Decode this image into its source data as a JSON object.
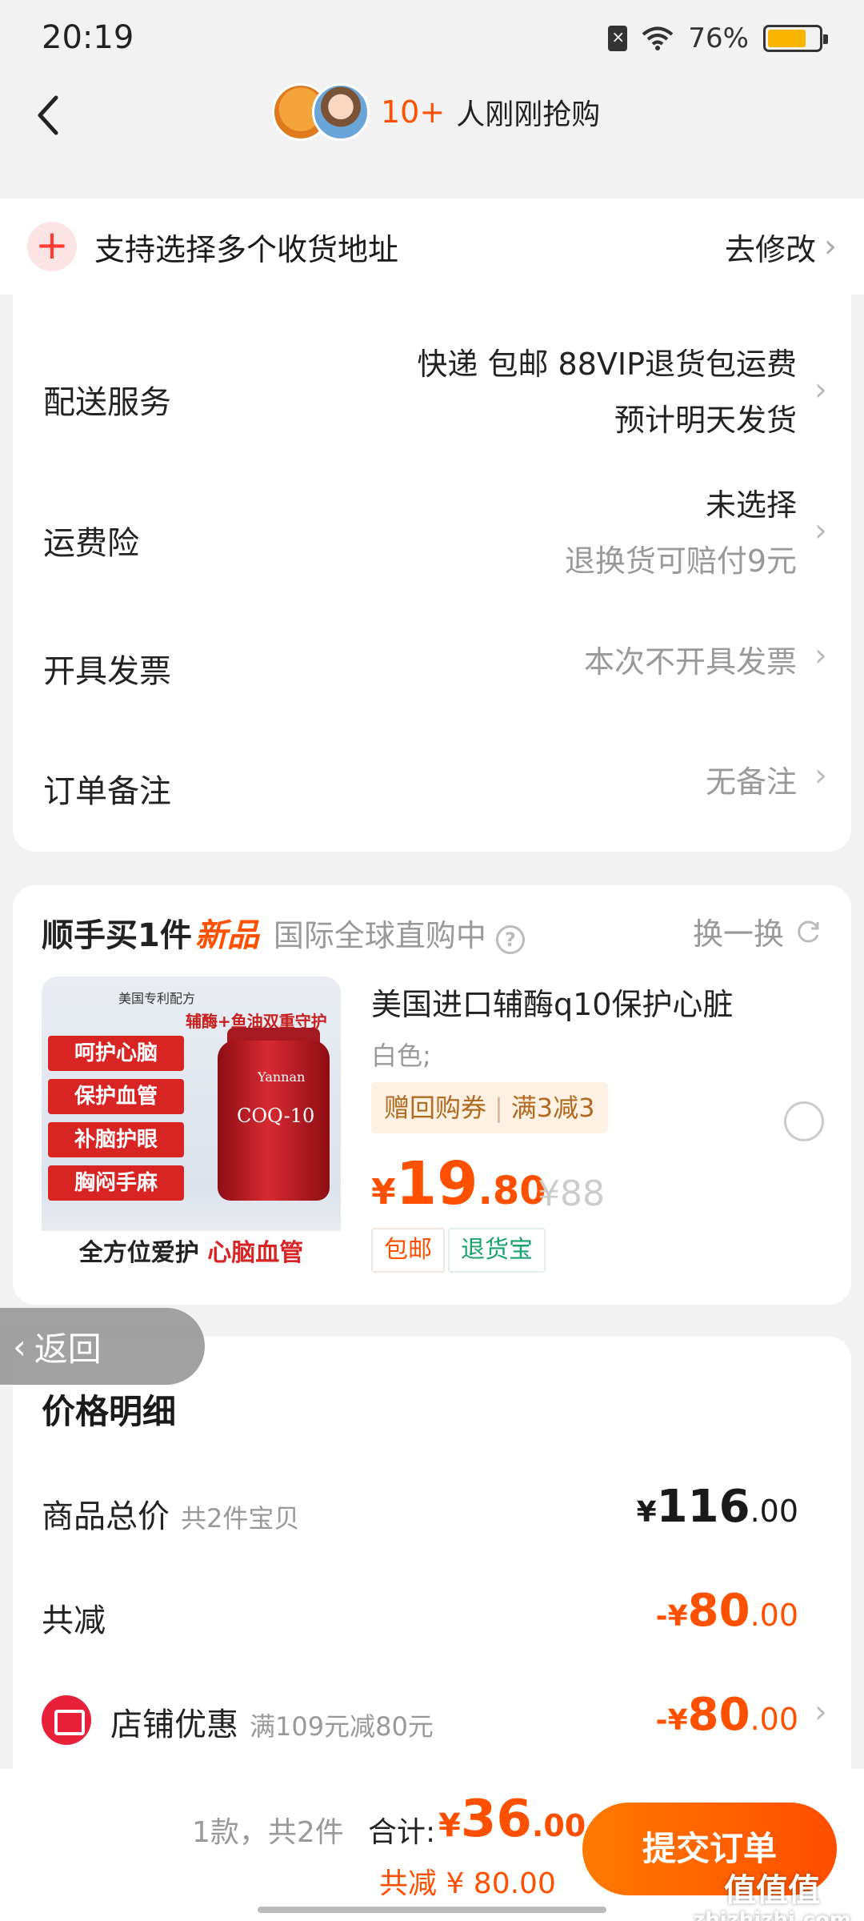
{
  "status_bar": {
    "time": "20:19",
    "battery_percent": "76%",
    "battery_level": 0.76
  },
  "header": {
    "buyers_count": "10+",
    "buyers_text": "人刚刚抢购"
  },
  "address": {
    "text": "支持选择多个收货地址",
    "modify": "去修改"
  },
  "services": {
    "delivery": {
      "label": "配送服务",
      "line1": "快递 包邮 88VIP退货包运费",
      "line2": "预计明天发货"
    },
    "insurance": {
      "label": "运费险",
      "line1": "未选择",
      "line2": "退换货可赔付9元"
    },
    "invoice": {
      "label": "开具发票",
      "value": "本次不开具发票"
    },
    "note": {
      "label": "订单备注",
      "value": "无备注"
    }
  },
  "addon": {
    "title": "顺手买1件",
    "new_tag": "新品",
    "intl": "国际全球直购中",
    "swap": "换一换",
    "product": {
      "name": "美国进口辅酶q10保护心脏",
      "spec": "白色;",
      "coupon_left": "赠回购券",
      "coupon_right": "满3减3",
      "price_currency": "¥",
      "price_int": "19",
      "price_dec": ".80",
      "orig_price": "¥88",
      "badge_post": "包邮",
      "badge_return": "退货宝",
      "image_texts": {
        "flag_text": "美国专利配方",
        "top_text": "辅酶+鱼油双重守护",
        "tags": [
          "呵护心脑",
          "保护血管",
          "补脑护眼",
          "胸闷手麻"
        ],
        "bottle_brand": "Yannan",
        "bottle_name": "COQ-10",
        "bottom_text_a": "全方位爱护",
        "bottom_text_b": "心脑血管"
      }
    }
  },
  "return_float": {
    "label": "返回"
  },
  "price_detail": {
    "title": "价格明细",
    "goods_total": {
      "label": "商品总价",
      "sub": "共2件宝贝",
      "currency": "¥",
      "int": "116",
      "dec": ".00"
    },
    "reduce": {
      "label": "共减",
      "currency": "-¥",
      "int": "80",
      "dec": ".00"
    },
    "shop_discount": {
      "label": "店铺优惠",
      "sub": "满109元减80元",
      "currency": "-¥",
      "int": "80",
      "dec": ".00"
    }
  },
  "bottom_bar": {
    "count": "1款，共2件",
    "total_label": "合计:",
    "total_currency": "¥",
    "total_int": "36",
    "total_dec": ".00",
    "saved": "共减 ¥ 80.00",
    "submit": "提交订单",
    "watermark_a": "值值值",
    "watermark_b": "zhizhizhi.com"
  }
}
